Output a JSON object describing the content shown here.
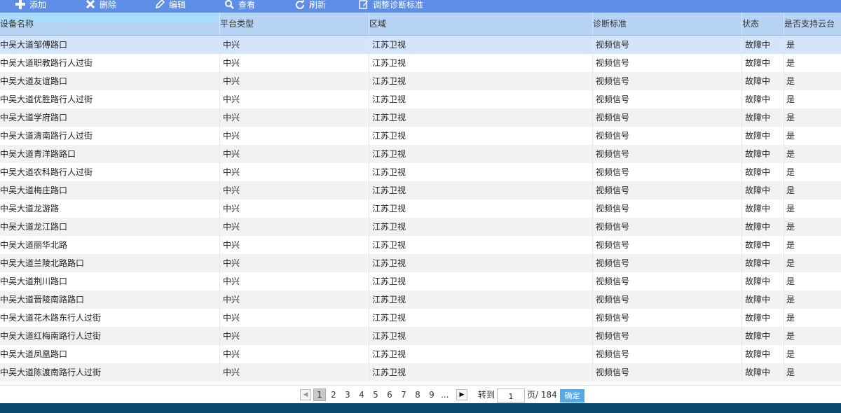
{
  "toolbar": {
    "add_label": "添加",
    "delete_label": "删除",
    "edit_label": "编辑",
    "view_label": "查看",
    "refresh_label": "刷新",
    "adjust_label": "调整诊断标准"
  },
  "table": {
    "headers": [
      "设备名称",
      "平台类型",
      "区域",
      "诊断标准",
      "状态",
      "是否支持云台"
    ],
    "rows": [
      [
        "中吴大道邹傅路口",
        "中兴",
        "江苏卫视",
        "视频信号",
        "故障中",
        "是"
      ],
      [
        "中吴大道职教路行人过街",
        "中兴",
        "江苏卫视",
        "视频信号",
        "故障中",
        "是"
      ],
      [
        "中吴大道友谊路口",
        "中兴",
        "江苏卫视",
        "视频信号",
        "故障中",
        "是"
      ],
      [
        "中吴大道优胜路行人过街",
        "中兴",
        "江苏卫视",
        "视频信号",
        "故障中",
        "是"
      ],
      [
        "中吴大道学府路口",
        "中兴",
        "江苏卫视",
        "视频信号",
        "故障中",
        "是"
      ],
      [
        "中吴大道清南路行人过街",
        "中兴",
        "江苏卫视",
        "视频信号",
        "故障中",
        "是"
      ],
      [
        "中吴大道青洋路路口",
        "中兴",
        "江苏卫视",
        "视频信号",
        "故障中",
        "是"
      ],
      [
        "中吴大道农科路行人过街",
        "中兴",
        "江苏卫视",
        "视频信号",
        "故障中",
        "是"
      ],
      [
        "中吴大道梅庄路口",
        "中兴",
        "江苏卫视",
        "视频信号",
        "故障中",
        "是"
      ],
      [
        "中吴大道龙游路",
        "中兴",
        "江苏卫视",
        "视频信号",
        "故障中",
        "是"
      ],
      [
        "中吴大道龙江路口",
        "中兴",
        "江苏卫视",
        "视频信号",
        "故障中",
        "是"
      ],
      [
        "中吴大道丽华北路",
        "中兴",
        "江苏卫视",
        "视频信号",
        "故障中",
        "是"
      ],
      [
        "中吴大道兰陵北路路口",
        "中兴",
        "江苏卫视",
        "视频信号",
        "故障中",
        "是"
      ],
      [
        "中吴大道荆川路口",
        "中兴",
        "江苏卫视",
        "视频信号",
        "故障中",
        "是"
      ],
      [
        "中吴大道晋陵南路路口",
        "中兴",
        "江苏卫视",
        "视频信号",
        "故障中",
        "是"
      ],
      [
        "中吴大道花木路东行人过街",
        "中兴",
        "江苏卫视",
        "视频信号",
        "故障中",
        "是"
      ],
      [
        "中吴大道红梅南路行人过街",
        "中兴",
        "江苏卫视",
        "视频信号",
        "故障中",
        "是"
      ],
      [
        "中吴大道凤凰路口",
        "中兴",
        "江苏卫视",
        "视频信号",
        "故障中",
        "是"
      ],
      [
        "中吴大道陈渡南路行人过街",
        "中兴",
        "江苏卫视",
        "视频信号",
        "故障中",
        "是"
      ]
    ]
  },
  "pager": {
    "pages": [
      "1",
      "2",
      "3",
      "4",
      "5",
      "6",
      "7",
      "8",
      "9"
    ],
    "ellipsis": "...",
    "current_page": "1",
    "goto_label": "转到",
    "page_input_value": "1",
    "total_label": "页/ 184",
    "confirm_label": "确定"
  },
  "colors": {
    "toolbar_bg": "#5f8ee6",
    "header_bg": "#b7d3f4",
    "selected_row": "#d4e4fb",
    "alt_row": "#f2f2f2",
    "confirm_bg": "#5aa8e8",
    "footer_bg": "#0a4a6e"
  }
}
